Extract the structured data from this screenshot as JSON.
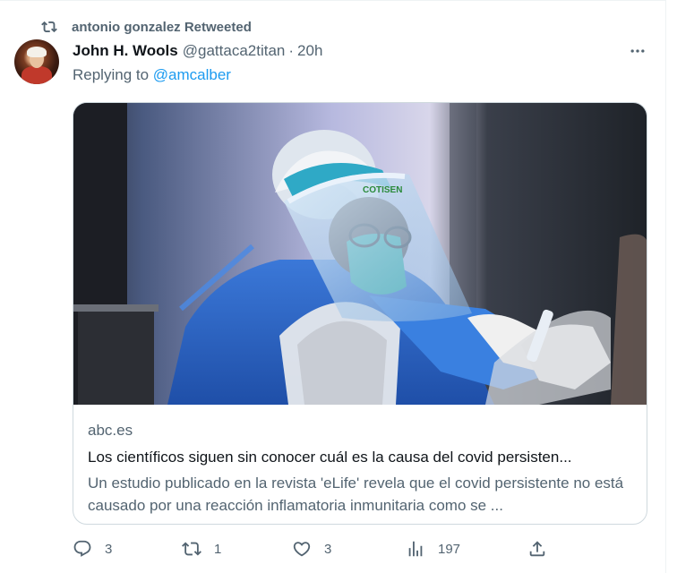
{
  "retweet": {
    "text": "antonio gonzalez Retweeted",
    "icon": "retweet-icon"
  },
  "author": {
    "name": "John H. Wools",
    "handle": "@gattaca2titan",
    "separator": "·",
    "time": "20h"
  },
  "reply": {
    "prefix": "Replying to ",
    "handle": "@amcalber"
  },
  "card": {
    "domain": "abc.es",
    "title": "Los científicos siguen sin conocer cuál es la causa del covid persisten...",
    "description": "Un estudio publicado en la revista 'eLife' revela que el covid persistente no está causado por una reacción inflamatoria inmunitaria como se ...",
    "image_visor_text": "COTISEN"
  },
  "actions": {
    "replies": "3",
    "retweets": "1",
    "likes": "3",
    "views": "197"
  },
  "colors": {
    "accent": "#1d9bf0",
    "secondary": "#536471",
    "border": "#cfd9de"
  }
}
